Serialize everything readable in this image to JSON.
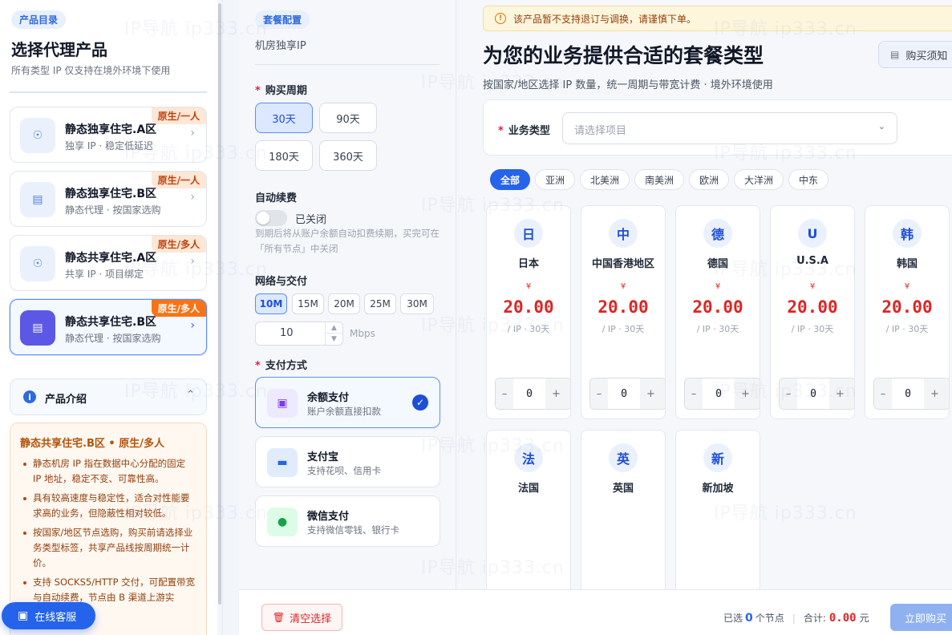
{
  "left": {
    "tag": "产品目录",
    "title": "选择代理产品",
    "subtitle": "所有类型 IP 仅支持在境外环境下使用",
    "products": [
      {
        "name": "静态独享住宅.A区",
        "desc": "独享 IP · 稳定低延迟",
        "tag": "原生/一人",
        "icon": "target-icon"
      },
      {
        "name": "静态独享住宅.B区",
        "desc": "静态代理 · 按国家选购",
        "tag": "原生/一人",
        "icon": "ticket-icon"
      },
      {
        "name": "静态共享住宅.A区",
        "desc": "共享 IP · 项目绑定",
        "tag": "原生/多人",
        "icon": "target-icon"
      },
      {
        "name": "静态共享住宅.B区",
        "desc": "静态代理 · 按国家选购",
        "tag": "原生/多人",
        "icon": "ticket-icon"
      }
    ],
    "intro_label": "产品介绍",
    "desc_title": "静态共享住宅.B区 • 原生/多人",
    "desc_points": [
      "静态机房 IP 指在数据中心分配的固定 IP 地址，稳定不变、可靠性高。",
      "具有较高速度与稳定性，适合对性能要求高的业务，但隐蔽性相对较低。",
      "按国家/地区节点选购，购买前请选择业务类型标签，共享产品线按周期统一计价。",
      "支持 SOCKS5/HTTP 交付，可配置带宽与自动续费，节点由 B 渠道上游实"
    ],
    "chat_label": "在线客服"
  },
  "mid": {
    "tag": "套餐配置",
    "subtitle": "机房独享IP",
    "period_label": "购买周期",
    "periods": [
      "30天",
      "90天",
      "180天",
      "360天"
    ],
    "renew_label": "自动续费",
    "renew_state": "已关闭",
    "renew_note": "到期后将从账户余额自动扣费续期，买完可在「所有节点」中关闭",
    "network_label": "网络与交付",
    "bandwidths": [
      "10M",
      "15M",
      "20M",
      "25M",
      "30M"
    ],
    "bandwidth_value": "10",
    "bandwidth_unit": "Mbps",
    "pay_label": "支付方式",
    "pay_methods": [
      {
        "title": "余额支付",
        "sub": "账户余额直接扣款"
      },
      {
        "title": "支付宝",
        "sub": "支持花呗、信用卡"
      },
      {
        "title": "微信支付",
        "sub": "支持微信零钱、银行卡"
      }
    ]
  },
  "right": {
    "alert": "该产品暂不支持退订与调换，请谨慎下单。",
    "title": "为您的业务提供合适的套餐类型",
    "notice_button": "购买须知",
    "subtitle": "按国家/地区选择 IP 数量，统一周期与带宽计费 · 境外环境使用",
    "biz_label": "业务类型",
    "biz_placeholder": "请选择项目",
    "regions": [
      "全部",
      "亚洲",
      "北美洲",
      "南美洲",
      "欧洲",
      "大洋洲",
      "中东"
    ],
    "countries": [
      {
        "badge": "日",
        "name": "日本",
        "currency": "¥",
        "price": "20.00",
        "per": "/ IP · 30天",
        "qty": "0"
      },
      {
        "badge": "中",
        "name": "中国香港地区",
        "currency": "¥",
        "price": "20.00",
        "per": "/ IP · 30天",
        "qty": "0"
      },
      {
        "badge": "德",
        "name": "德国",
        "currency": "¥",
        "price": "20.00",
        "per": "/ IP · 30天",
        "qty": "0"
      },
      {
        "badge": "U",
        "name": "U.S.A",
        "currency": "¥",
        "price": "20.00",
        "per": "/ IP · 30天",
        "qty": "0"
      },
      {
        "badge": "韩",
        "name": "韩国",
        "currency": "¥",
        "price": "20.00",
        "per": "/ IP · 30天",
        "qty": "0"
      },
      {
        "badge": "法",
        "name": "法国"
      },
      {
        "badge": "英",
        "name": "英国"
      },
      {
        "badge": "新",
        "name": "新加坡"
      }
    ]
  },
  "footer": {
    "clear_label": "清空选择",
    "selected_prefix": "已选",
    "selected_count": "0",
    "selected_suffix": "个节点",
    "total_label": "合计:",
    "total_amount": "0.00",
    "total_unit": "元",
    "buy_label": "立即购买"
  },
  "watermark": "IP导航  ip333.cn",
  "colors": {
    "accent": "#2563eb",
    "price": "#dc2626",
    "tag": "#f97316"
  }
}
